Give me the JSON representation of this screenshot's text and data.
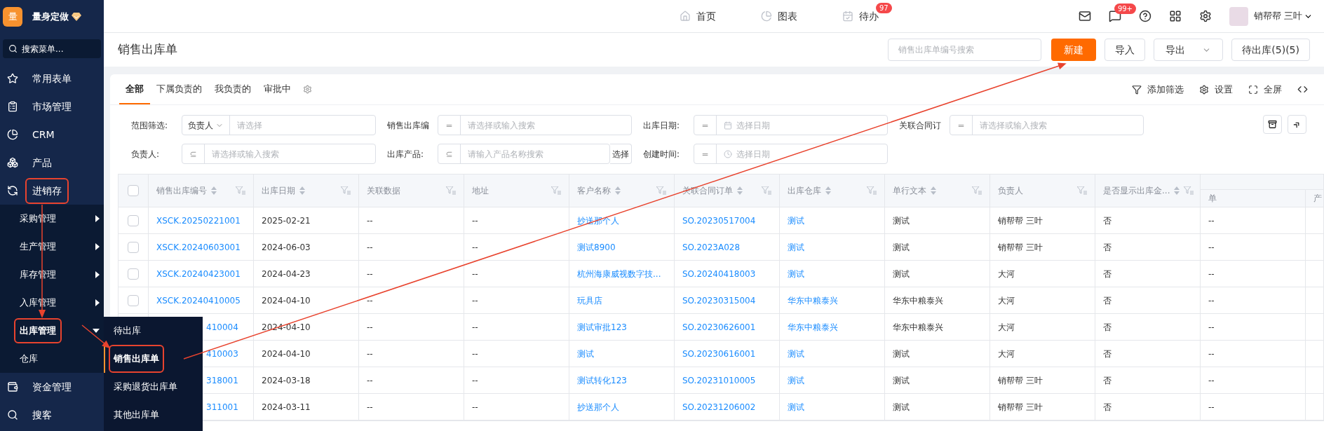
{
  "brand": {
    "logo": "量",
    "name": "量身定做"
  },
  "sidebar": {
    "search_placeholder": "搜索菜单...",
    "items": [
      {
        "label": "常用表单",
        "highlighted": false
      },
      {
        "label": "市场管理",
        "highlighted": false
      },
      {
        "label": "CRM",
        "highlighted": false
      },
      {
        "label": "产品",
        "highlighted": false
      },
      {
        "label": "进销存",
        "highlighted": true,
        "children": [
          {
            "label": "采购管理",
            "has_submenu": true,
            "expanded": false,
            "highlighted": false
          },
          {
            "label": "生产管理",
            "has_submenu": true,
            "expanded": false,
            "highlighted": false
          },
          {
            "label": "库存管理",
            "has_submenu": true,
            "expanded": false,
            "highlighted": false
          },
          {
            "label": "入库管理",
            "has_submenu": true,
            "expanded": false,
            "highlighted": false
          },
          {
            "label": "出库管理",
            "has_submenu": true,
            "expanded": true,
            "highlighted": true,
            "children": [
              {
                "label": "待出库",
                "selected": false,
                "highlighted": false
              },
              {
                "label": "销售出库单",
                "selected": true,
                "highlighted": true
              },
              {
                "label": "采购退货出库单",
                "selected": false,
                "highlighted": false
              },
              {
                "label": "其他出库单",
                "selected": false,
                "highlighted": false
              }
            ]
          },
          {
            "label": "仓库",
            "has_submenu": false,
            "expanded": false,
            "highlighted": false
          }
        ]
      },
      {
        "label": "资金管理",
        "highlighted": false
      },
      {
        "label": "搜客",
        "highlighted": false
      }
    ]
  },
  "top_nav": [
    {
      "label": "首页"
    },
    {
      "label": "图表"
    },
    {
      "label": "待办",
      "badge": "97"
    }
  ],
  "message_badge": "99+",
  "user": {
    "name": "销帮帮 三叶"
  },
  "page": {
    "title": "销售出库单",
    "search_placeholder": "销售出库单编号搜索",
    "buttons": [
      {
        "label": "新建",
        "kind": "primary"
      },
      {
        "label": "导入",
        "kind": "default"
      },
      {
        "label": "导出",
        "kind": "dropdown"
      },
      {
        "label": "待出库(5)(5)",
        "kind": "default"
      }
    ]
  },
  "tabs": [
    {
      "label": "全部",
      "selected": true
    },
    {
      "label": "下属负责的",
      "selected": false
    },
    {
      "label": "我负责的",
      "selected": false
    },
    {
      "label": "审批中",
      "selected": false
    }
  ],
  "tools": [
    {
      "label": "添加筛选"
    },
    {
      "label": "设置"
    },
    {
      "label": "全屏"
    }
  ],
  "filters": [
    [
      {
        "label": "范围筛选:",
        "kind": "select",
        "operator": "负责人",
        "placeholder": "请选择"
      },
      {
        "label": "销售出库编",
        "kind": "text",
        "operator": "=",
        "placeholder": "请选择或输入搜索"
      },
      {
        "label": "出库日期:",
        "kind": "date",
        "operator": "=",
        "placeholder": "选择日期"
      },
      {
        "label": "关联合同订",
        "kind": "text",
        "operator": "=",
        "placeholder": "请选择或输入搜索"
      }
    ],
    [
      {
        "label": "负责人:",
        "kind": "text",
        "operator": "⊆",
        "placeholder": "请选择或输入搜索"
      },
      {
        "label": "出库产品:",
        "kind": "picker",
        "operator": "⊆",
        "placeholder": "请输入产品名称搜索",
        "button": "选择"
      },
      {
        "label": "创建时间:",
        "kind": "time",
        "operator": "=",
        "placeholder": "选择日期"
      }
    ]
  ],
  "table": {
    "all_checked": false,
    "columns": [
      {
        "label": "销售出库编号",
        "sortable": true,
        "link": true
      },
      {
        "label": "出库日期",
        "sortable": true,
        "link": false
      },
      {
        "label": "关联数据",
        "sortable": false,
        "link": false
      },
      {
        "label": "地址",
        "sortable": false,
        "link": false
      },
      {
        "label": "客户名称",
        "sortable": true,
        "link": true
      },
      {
        "label": "关联合同订单",
        "sortable": true,
        "link": true
      },
      {
        "label": "出库仓库",
        "sortable": true,
        "link": true
      },
      {
        "label": "单行文本",
        "sortable": true,
        "link": false
      },
      {
        "label": "负责人",
        "sortable": false,
        "link": false
      },
      {
        "label": "是否显示出库金...",
        "sortable": true,
        "link": false
      }
    ],
    "group_columns": [
      "单",
      "产"
    ],
    "rows": [
      {
        "checked": false,
        "under_menu": false,
        "cells": [
          "XSCK.20250221001",
          "2025-02-21",
          "--",
          "--",
          "抄送那个人",
          "SO.20230517004",
          "测试",
          "测试",
          "销帮帮 三叶",
          "否",
          "--"
        ]
      },
      {
        "checked": false,
        "under_menu": false,
        "cells": [
          "XSCK.20240603001",
          "2024-06-03",
          "--",
          "--",
          "测试8900",
          "SO.2023A028",
          "测试",
          "测试",
          "销帮帮 三叶",
          "否",
          "--"
        ]
      },
      {
        "checked": false,
        "under_menu": false,
        "cells": [
          "XSCK.20240423001",
          "2024-04-23",
          "--",
          "--",
          "杭州海康威视数字技...",
          "SO.20240418003",
          "测试",
          "测试",
          "大河",
          "否",
          "--"
        ]
      },
      {
        "checked": false,
        "under_menu": false,
        "cells": [
          "XSCK.20240410005",
          "2024-04-10",
          "--",
          "--",
          "玩具店",
          "SO.20230315004",
          "华东中粮泰兴",
          "华东中粮泰兴",
          "大河",
          "否",
          "--"
        ]
      },
      {
        "under_menu": true,
        "cells": [
          "410004",
          "2024-04-10",
          "--",
          "--",
          "测试审批123",
          "SO.20230626001",
          "华东中粮泰兴",
          "华东中粮泰兴",
          "大河",
          "否",
          "--"
        ]
      },
      {
        "under_menu": true,
        "cells": [
          "410003",
          "2024-04-10",
          "--",
          "--",
          "测试",
          "SO.20230616001",
          "测试",
          "测试",
          "大河",
          "否",
          "--"
        ]
      },
      {
        "under_menu": true,
        "cells": [
          "318001",
          "2024-03-18",
          "--",
          "--",
          "测试转化123",
          "SO.20231010005",
          "测试",
          "测试",
          "销帮帮 三叶",
          "否",
          "--"
        ]
      },
      {
        "under_menu": true,
        "cells": [
          "311001",
          "2024-03-11",
          "--",
          "--",
          "抄送那个人",
          "SO.20231206002",
          "测试",
          "测试",
          "销帮帮 三叶",
          "否",
          "--"
        ]
      }
    ]
  }
}
